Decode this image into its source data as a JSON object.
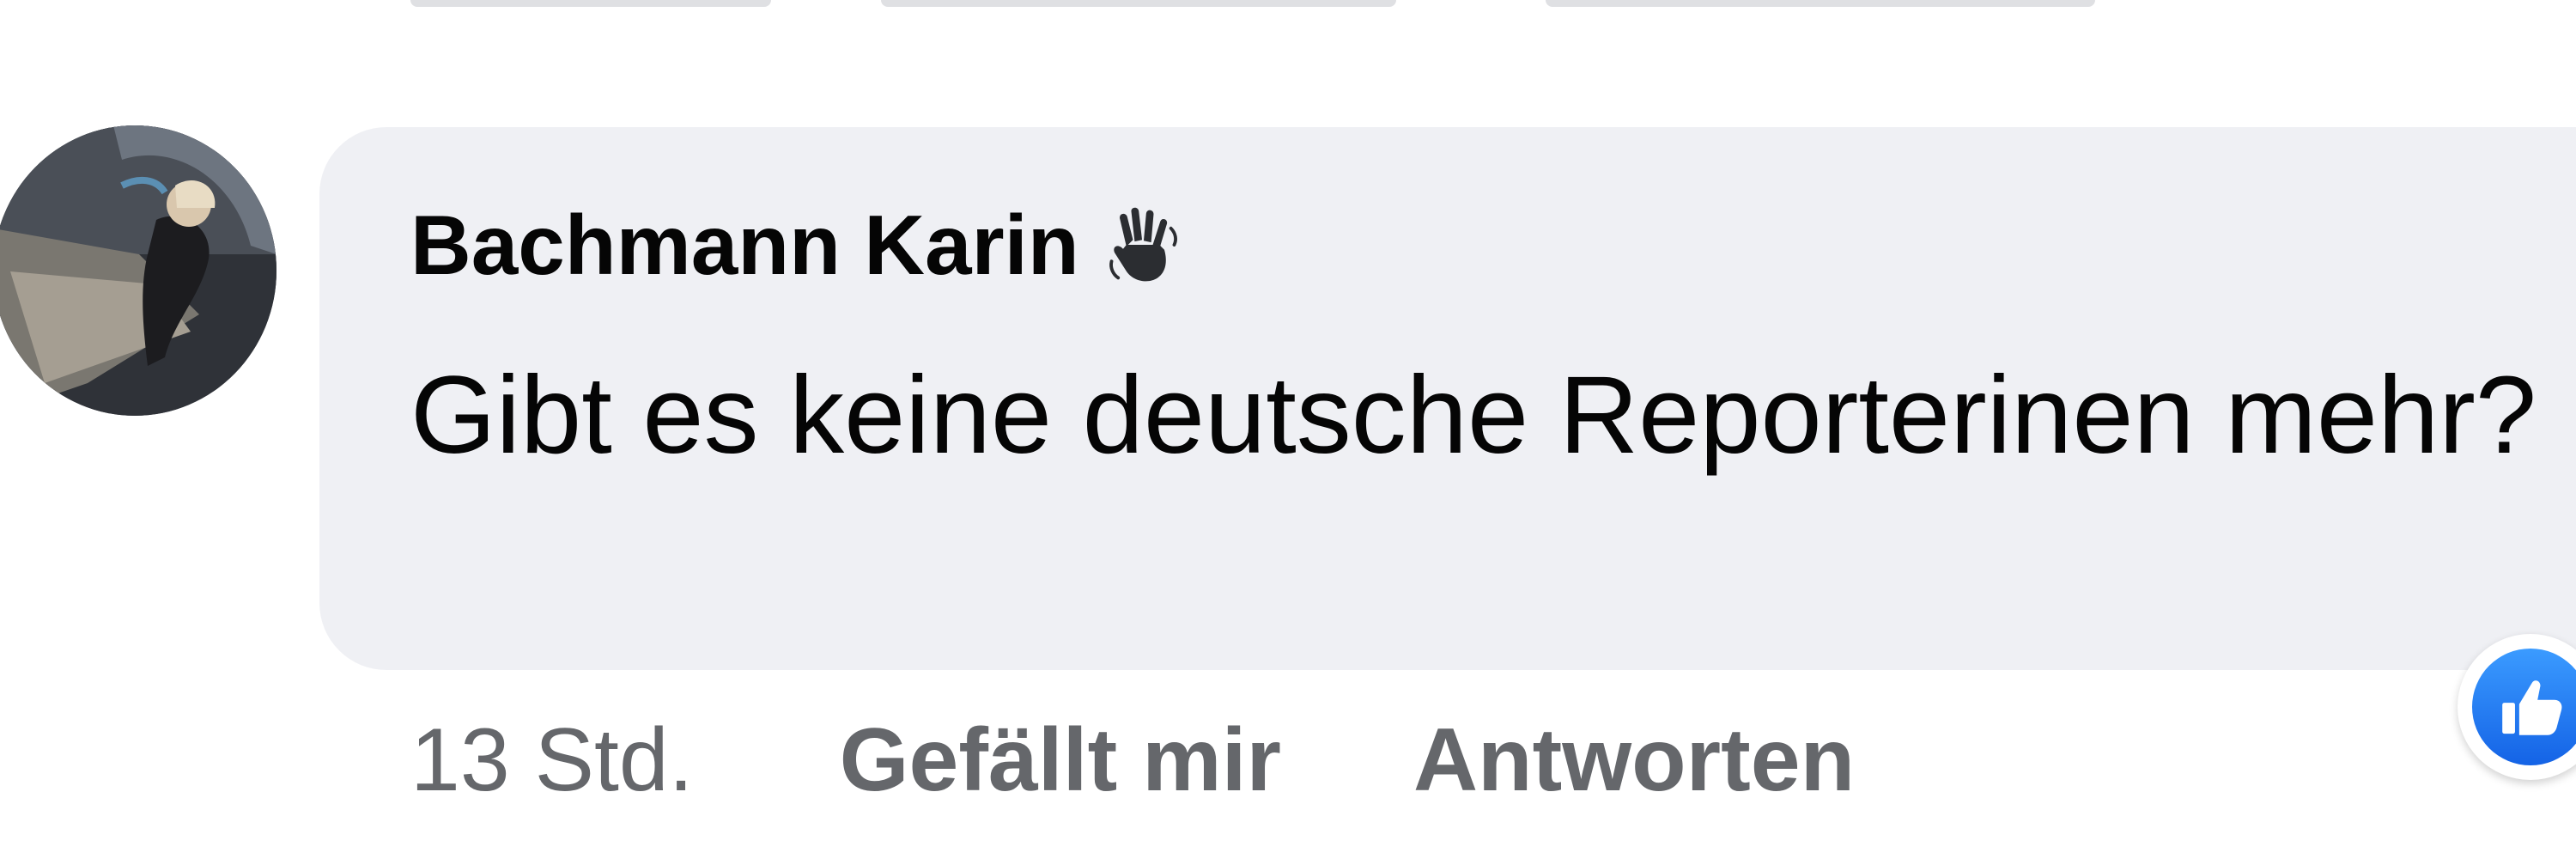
{
  "comment": {
    "author": "Bachmann Karin",
    "author_badge_icon": "waving-hand-icon",
    "text": "Gibt es keine deutsche Reporterinen mehr?",
    "timestamp": "13 Std.",
    "like_label": "Gefällt mir",
    "reply_label": "Antworten",
    "reaction_icon": "thumbs-up-icon"
  },
  "colors": {
    "bubble_background": "#eff0f4",
    "text_primary": "#050505",
    "text_secondary": "#65676b",
    "like_blue": "#1877f2"
  }
}
